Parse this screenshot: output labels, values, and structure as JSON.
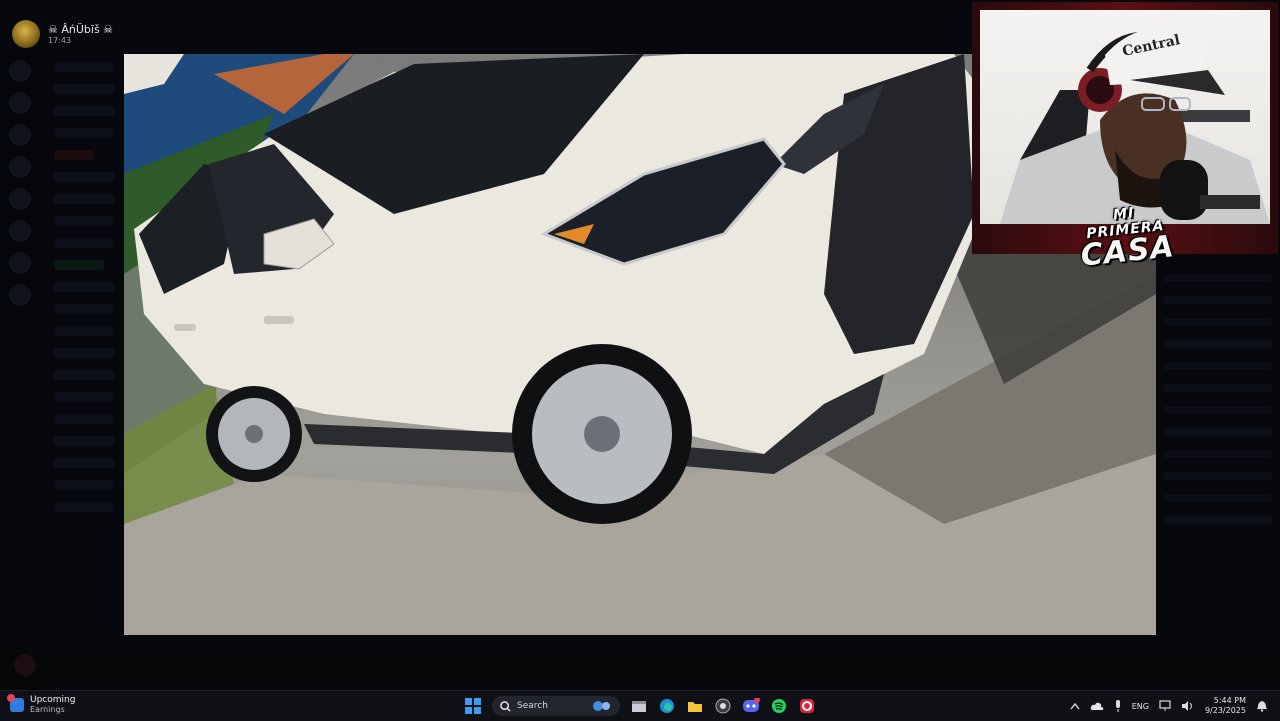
{
  "window": {
    "title": ""
  },
  "background_app": {
    "breadcrumb": ""
  },
  "stream_header": {
    "user_name": "☠ ÂńÜbīš ☠",
    "time": "17:43"
  },
  "webcam": {
    "hat_text": "Central",
    "overlay_line1": "MI PRIMERA",
    "overlay_line2": "CASA"
  },
  "taskbar": {
    "widget": {
      "title": "Upcoming",
      "subtitle": "Earnings",
      "icon": "calendar-icon"
    },
    "search": {
      "placeholder": "Search"
    },
    "pinned_apps": [
      "file-explorer-icon",
      "edge-icon",
      "folder-icon",
      "chrome-icon",
      "discord-icon",
      "spotify-icon",
      "opera-icon"
    ],
    "tray": {
      "language": "ENG"
    },
    "clock": {
      "time": "5:44 PM",
      "date": "9/23/2025"
    }
  },
  "colors": {
    "taskbar_bg": "#0f1116",
    "accent_blue": "#2f7de1",
    "discord_purple": "#5865f2",
    "spotify_green": "#1ed760",
    "overlay_red": "#5b1014"
  }
}
